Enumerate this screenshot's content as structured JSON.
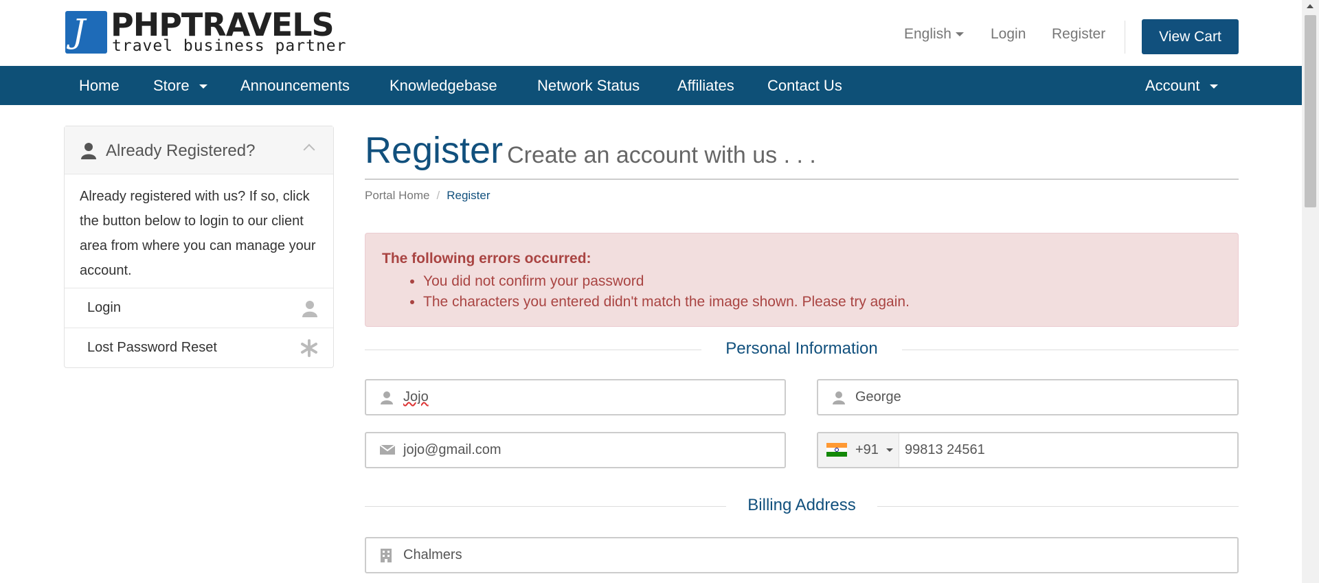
{
  "brand": {
    "logo_mark": "J",
    "title": "PHPTRAVELS",
    "subtitle": "travel business partner"
  },
  "top_links": {
    "language": "English",
    "login": "Login",
    "register": "Register",
    "view_cart": "View Cart"
  },
  "nav": {
    "items": [
      "Home",
      "Store",
      "Announcements",
      "Knowledgebase",
      "Network Status",
      "Affiliates",
      "Contact Us"
    ],
    "account": "Account"
  },
  "sidebar": {
    "title": "Already Registered?",
    "body": "Already registered with us? If so, click the button below to login to our client area from where you can manage your account.",
    "links": [
      "Login",
      "Lost Password Reset"
    ]
  },
  "page": {
    "title": "Register",
    "subtitle": "Create an account with us . . .",
    "breadcrumb": [
      "Portal Home",
      "Register"
    ]
  },
  "alert": {
    "title": "The following errors occurred:",
    "errors": [
      "You did not confirm your password",
      "The characters you entered didn't match the image shown. Please try again."
    ]
  },
  "sections": {
    "personal": "Personal Information",
    "billing": "Billing Address"
  },
  "form": {
    "first_name": "Jojo",
    "last_name": "George",
    "email": "jojo@gmail.com",
    "phone_code": "+91",
    "phone": "99813 24561",
    "company": "Chalmers"
  },
  "colors": {
    "brand_blue": "#0e5077",
    "alert_bg": "#f2dede",
    "alert_text": "#a94442"
  }
}
